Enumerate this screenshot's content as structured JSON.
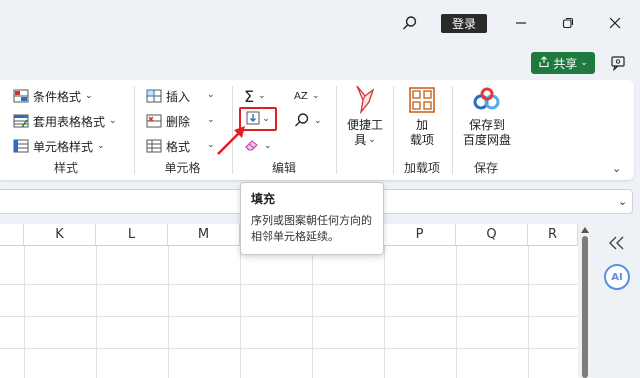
{
  "titlebar": {
    "login_label": "登录"
  },
  "share": {
    "label": "共享"
  },
  "ribbon": {
    "styles_group": {
      "label": "样式",
      "conditional_format": "条件格式",
      "table_format": "套用表格格式",
      "cell_style": "单元格样式"
    },
    "cells_group": {
      "label": "单元格",
      "insert": "插入",
      "delete": "删除",
      "format": "格式"
    },
    "edit_group": {
      "label": "编辑",
      "sum_symbol": "Σ",
      "sort_symbol": "AZ"
    },
    "tools_group": {
      "label_line1": "便捷工",
      "label_line2": "具"
    },
    "addins_group": {
      "button_line1": "加",
      "button_line2": "载项",
      "label": "加载项"
    },
    "save_group": {
      "button_line1": "保存到",
      "button_line2": "百度网盘",
      "label": "保存"
    }
  },
  "tooltip": {
    "title": "填充",
    "body": "序列或图案朝任何方向的相邻单元格延续。"
  },
  "columns": [
    "K",
    "L",
    "M",
    "N",
    "O",
    "P",
    "Q",
    "R"
  ],
  "sidepanel": {
    "ai_label": "AI"
  },
  "colors": {
    "share_green": "#1f7a3f",
    "highlight_red": "#e02020",
    "ai_blue": "#5a8fe0"
  }
}
